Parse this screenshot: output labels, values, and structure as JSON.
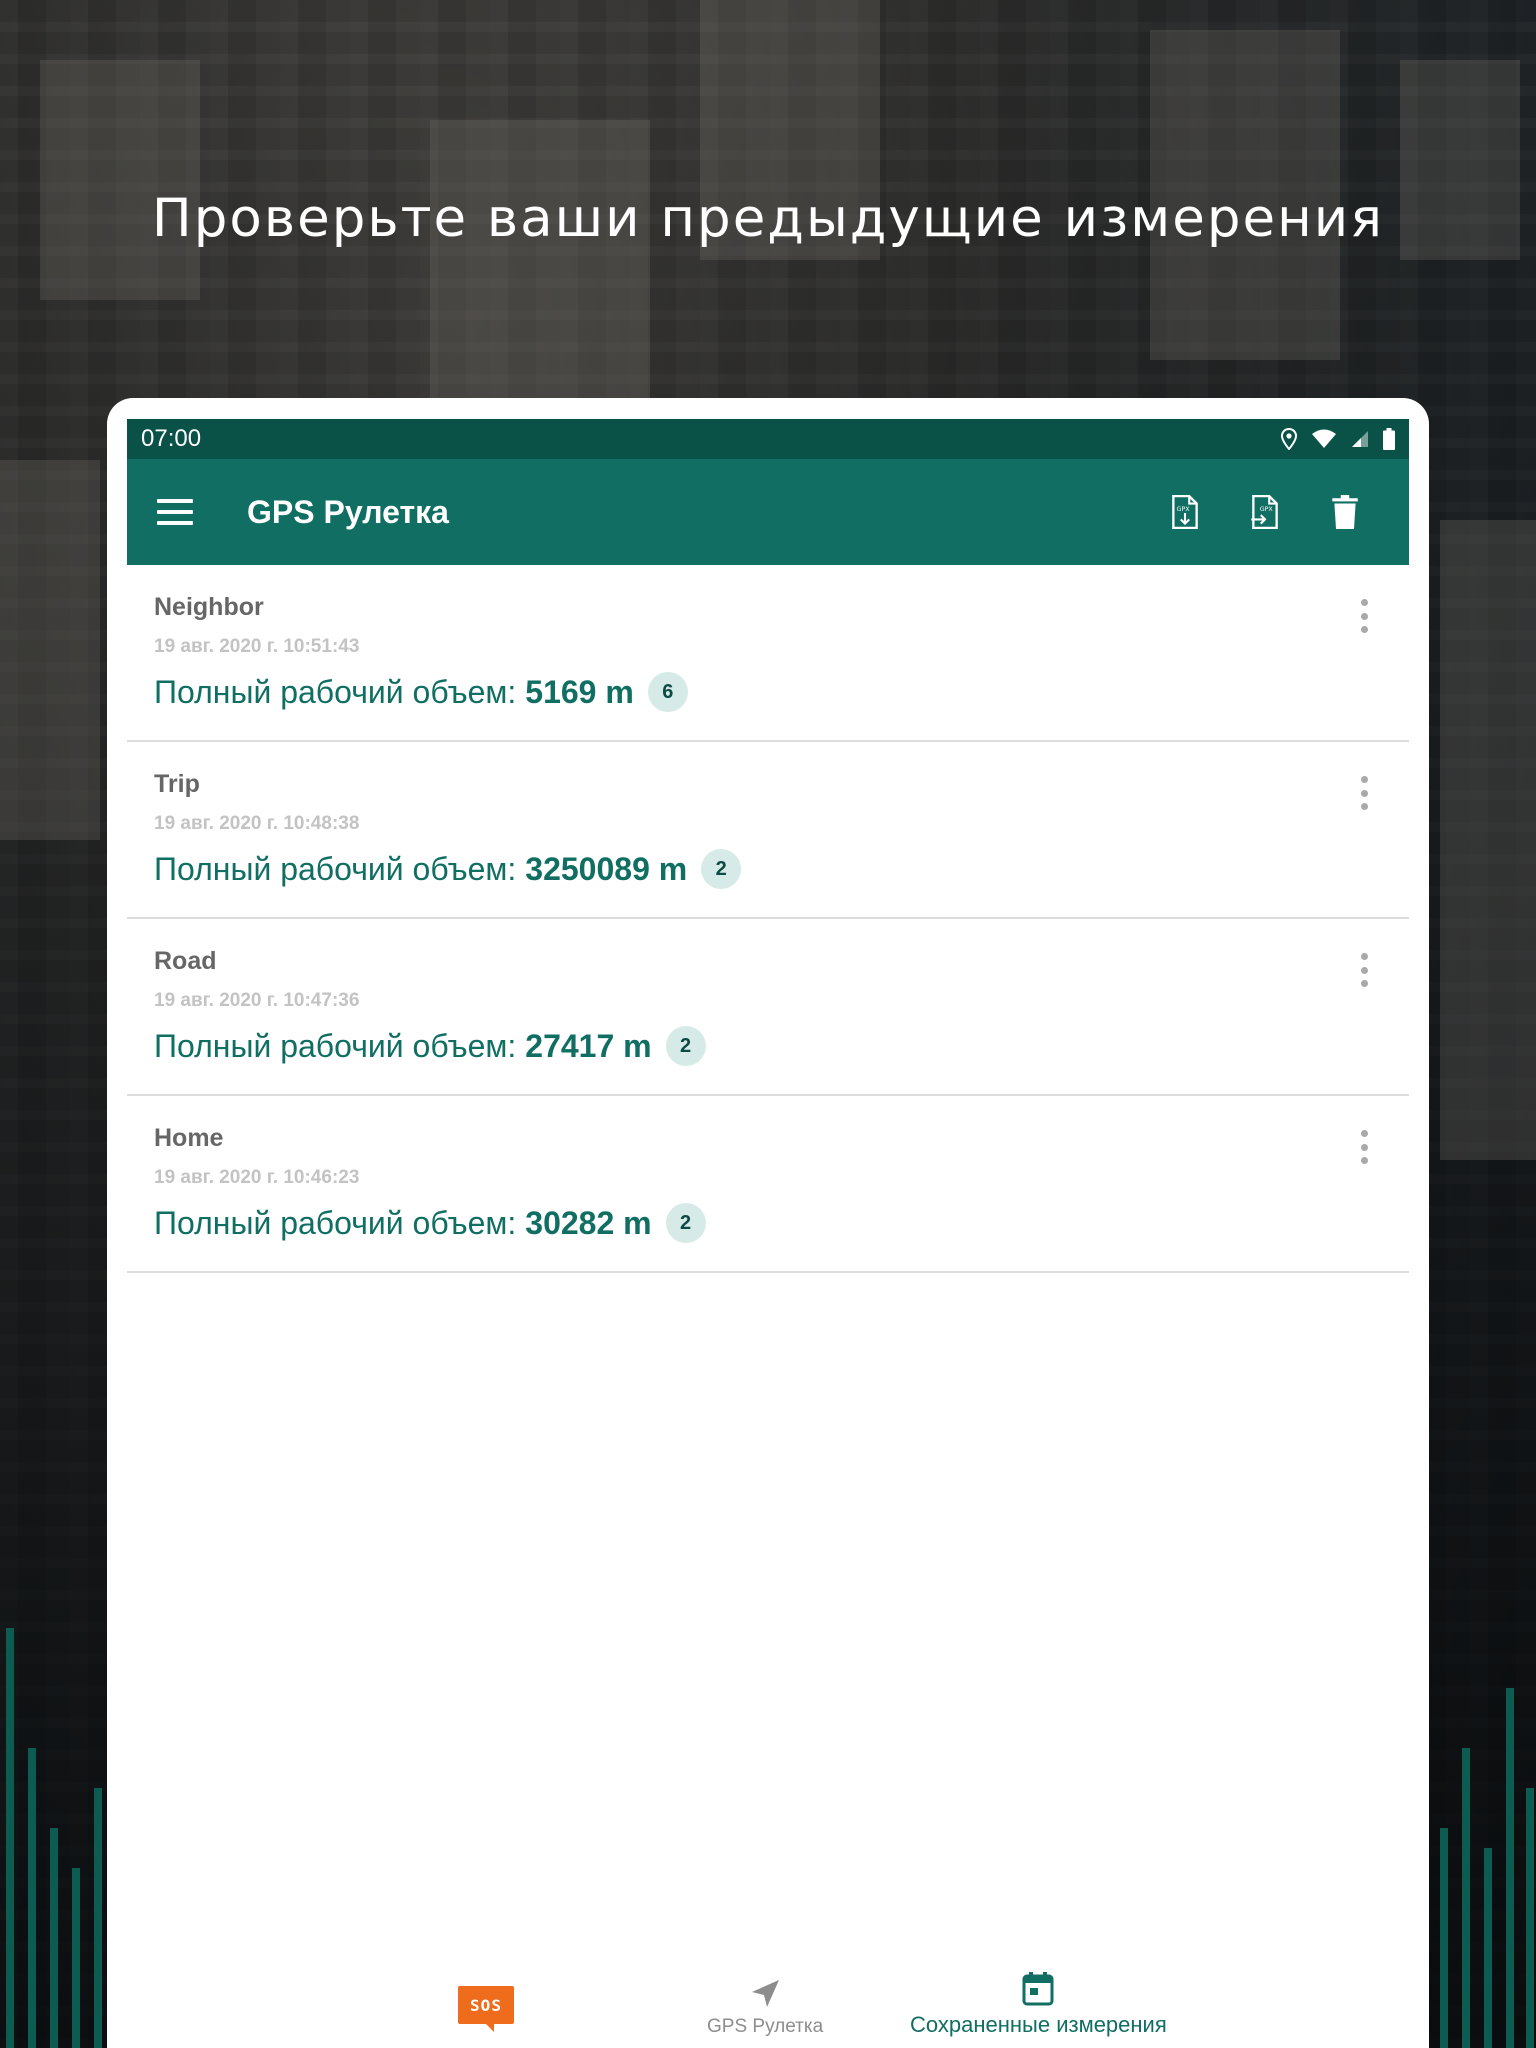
{
  "headline": "Проверьте ваши предыдущие измерения",
  "statusbar": {
    "time": "07:00"
  },
  "appbar": {
    "title": "GPS Рулетка"
  },
  "colors": {
    "primary": "#106e62",
    "primary_dark": "#0a5148",
    "badge_bg": "#d6ebe7",
    "sos": "#ef6c1d"
  },
  "measurements": [
    {
      "name": "Neighbor",
      "date": "19 авг. 2020 г. 10:51:43",
      "label": "Полный рабочий объем:",
      "value": "5169 m",
      "count": "6"
    },
    {
      "name": "Trip",
      "date": "19 авг. 2020 г. 10:48:38",
      "label": "Полный рабочий объем:",
      "value": "3250089 m",
      "count": "2"
    },
    {
      "name": "Road",
      "date": "19 авг. 2020 г. 10:47:36",
      "label": "Полный рабочий объем:",
      "value": "27417 m",
      "count": "2"
    },
    {
      "name": "Home",
      "date": "19 авг. 2020 г. 10:46:23",
      "label": "Полный рабочий объем:",
      "value": "30282 m",
      "count": "2"
    }
  ],
  "bottomnav": {
    "sos": "SOS",
    "gps": "GPS Рулетка",
    "saved": "Сохраненные измерения",
    "active": "saved"
  },
  "icons": {
    "menu": "menu-icon",
    "export": "gpx-export-icon",
    "import": "gpx-import-icon",
    "delete": "trash-icon",
    "location": "location-pin-icon",
    "wifi": "wifi-icon",
    "signal": "cell-signal-icon",
    "battery": "battery-icon",
    "more": "more-vert-icon",
    "navigate": "navigation-arrow-icon",
    "calendar": "calendar-icon"
  }
}
